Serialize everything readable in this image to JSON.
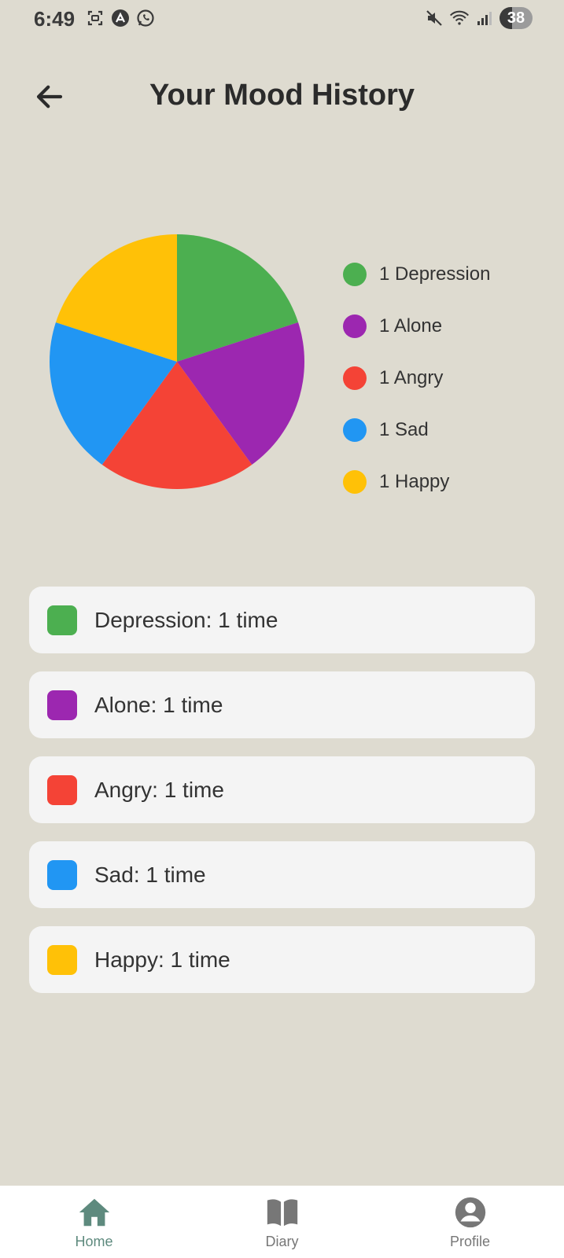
{
  "status_bar": {
    "time": "6:49",
    "battery": "38"
  },
  "header": {
    "title": "Your Mood History"
  },
  "chart_data": {
    "type": "pie",
    "categories": [
      "Depression",
      "Alone",
      "Angry",
      "Sad",
      "Happy"
    ],
    "values": [
      1,
      1,
      1,
      1,
      1
    ],
    "colors": [
      "#4caf50",
      "#9c27b0",
      "#f44336",
      "#2196f3",
      "#ffc107"
    ],
    "legend_labels": [
      "1 Depression",
      "1 Alone",
      "1 Angry",
      "1 Sad",
      "1 Happy"
    ],
    "legend_placement": "right"
  },
  "mood_list": [
    {
      "label": "Depression: 1 time",
      "color": "#4caf50"
    },
    {
      "label": "Alone: 1 time",
      "color": "#9c27b0"
    },
    {
      "label": "Angry: 1 time",
      "color": "#f44336"
    },
    {
      "label": "Sad: 1 time",
      "color": "#2196f3"
    },
    {
      "label": "Happy: 1 time",
      "color": "#ffc107"
    }
  ],
  "bottom_nav": {
    "items": [
      {
        "label": "Home",
        "icon": "home-icon",
        "active": true
      },
      {
        "label": "Diary",
        "icon": "book-icon",
        "active": false
      },
      {
        "label": "Profile",
        "icon": "account-icon",
        "active": false
      }
    ],
    "active_color": "#5e8a7e",
    "inactive_color": "#777777"
  }
}
